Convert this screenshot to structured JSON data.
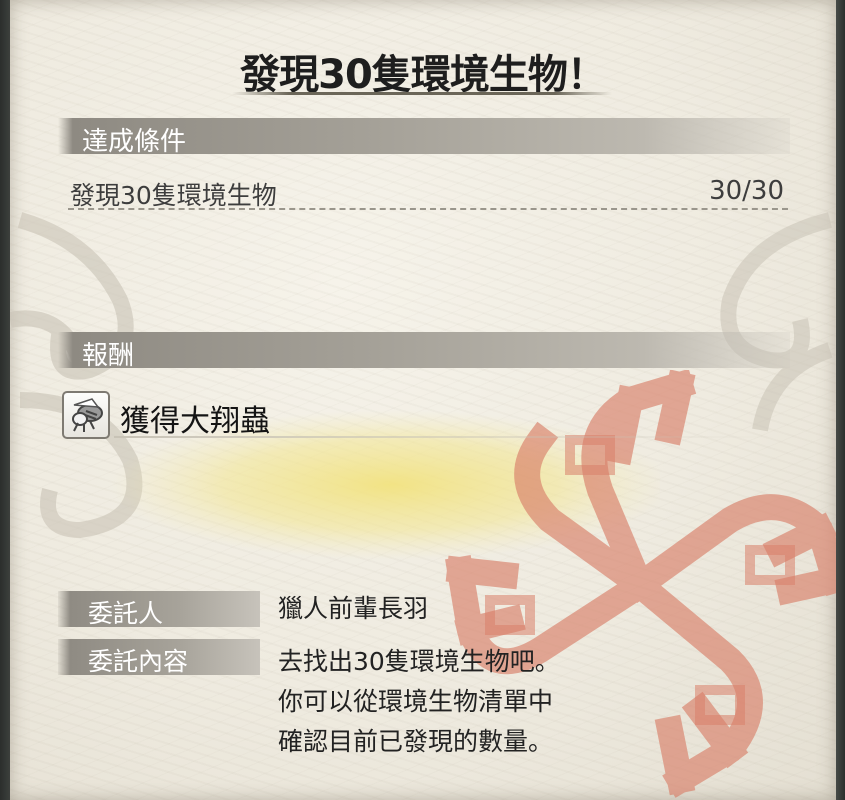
{
  "title": "發現30隻環境生物！",
  "conditions": {
    "header": "達成條件",
    "items": [
      {
        "label": "發現30隻環境生物",
        "progress": "30/30"
      }
    ]
  },
  "rewards": {
    "header": "報酬",
    "items": [
      {
        "icon": "insect-icon",
        "label": "獲得大翔蟲"
      }
    ]
  },
  "client": {
    "label": "委託人",
    "value": "獵人前輩長羽"
  },
  "request": {
    "label": "委託內容",
    "lines": [
      "去找出30隻環境生物吧。",
      "你可以從環境生物清單中",
      "確認目前已發現的數量。"
    ]
  },
  "colors": {
    "paper": "#efebe0",
    "section_bar": "#a6a299",
    "emblem": "#d9806a",
    "highlight": "#f2e27a"
  }
}
